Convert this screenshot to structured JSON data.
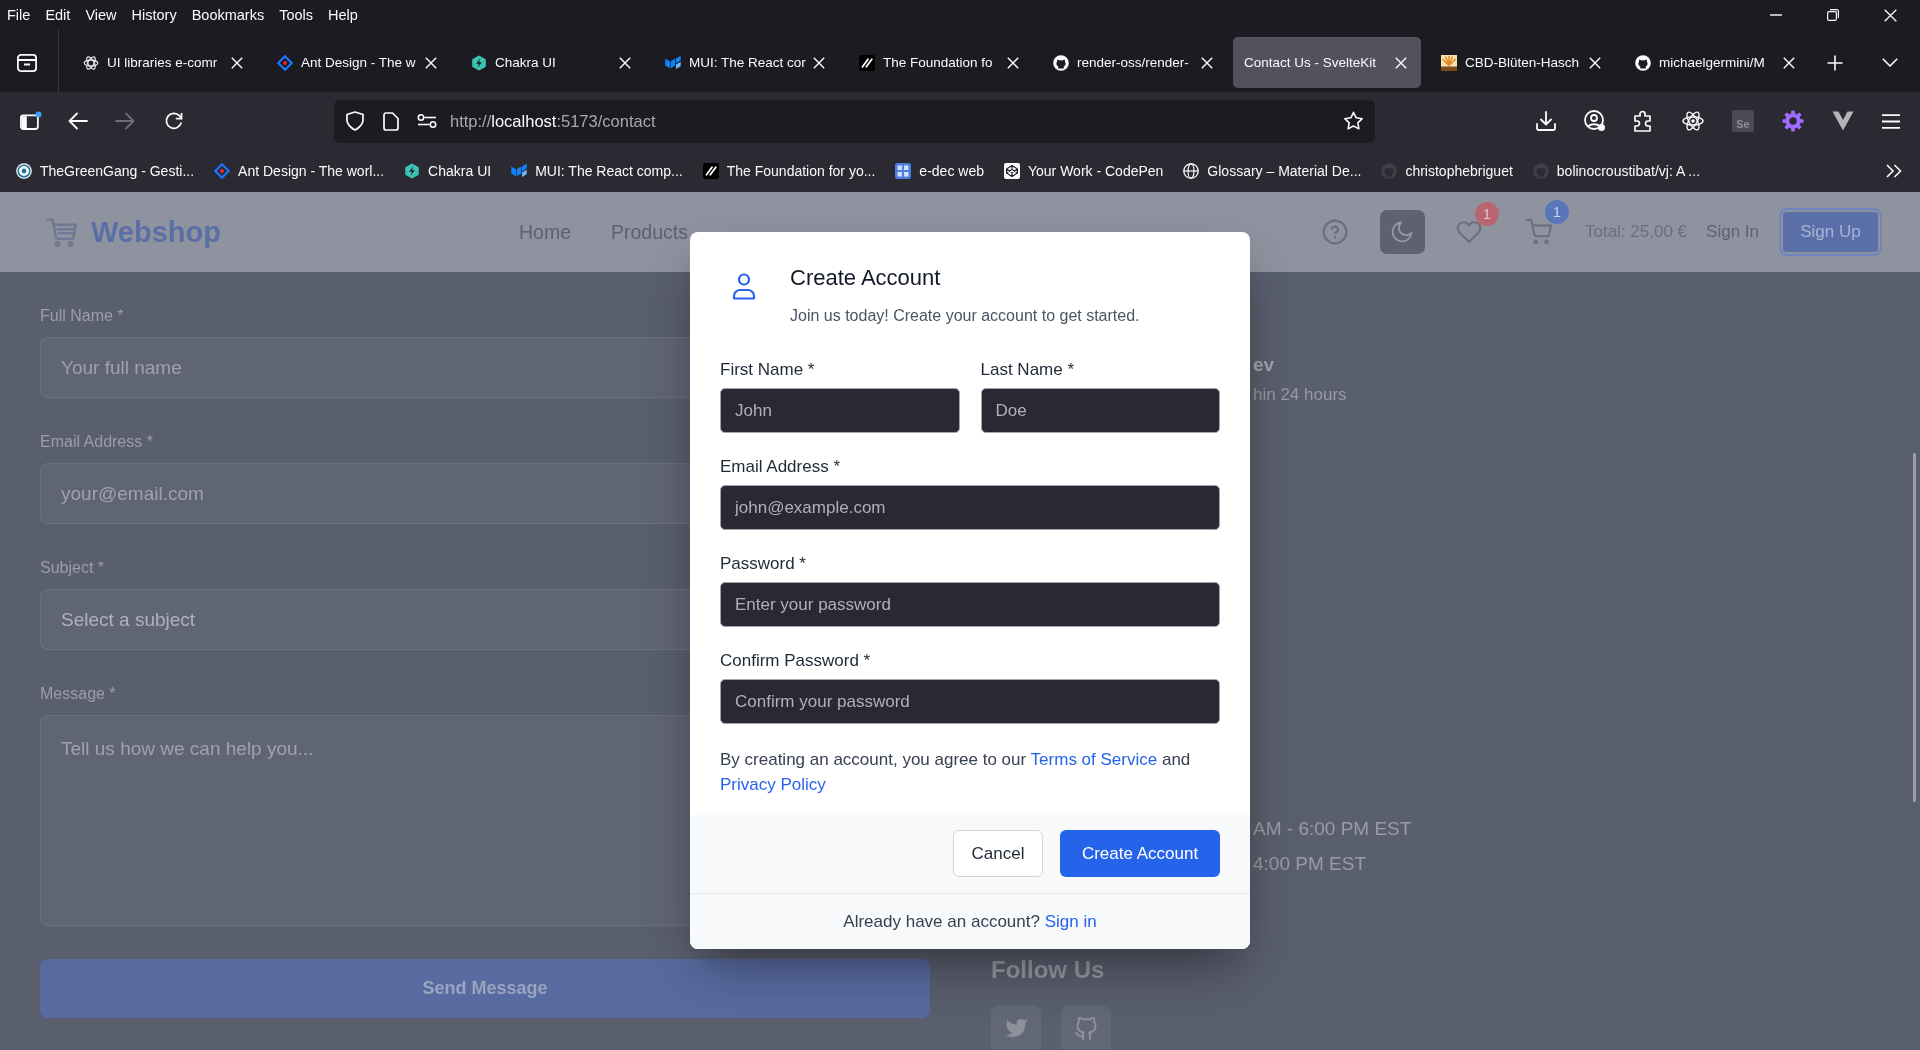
{
  "browser": {
    "menu": [
      "File",
      "Edit",
      "View",
      "History",
      "Bookmarks",
      "Tools",
      "Help"
    ],
    "tabs": [
      {
        "title": "UI libraries e-comr",
        "selected": false
      },
      {
        "title": "Ant Design - The w",
        "selected": false
      },
      {
        "title": "Chakra UI",
        "selected": false
      },
      {
        "title": "MUI: The React cor",
        "selected": false
      },
      {
        "title": "The Foundation fo",
        "selected": false
      },
      {
        "title": "render-oss/render-",
        "selected": false
      },
      {
        "title": "Contact Us - SvelteKit",
        "selected": true
      },
      {
        "title": "CBD-Blüten-Hasch",
        "selected": false
      },
      {
        "title": "michaelgermini/M",
        "selected": false
      }
    ],
    "toolbar": {
      "forward_disabled": true,
      "url": {
        "scheme": "http://",
        "host": "localhost",
        "path": ":5173/contact"
      },
      "extension_label": "Se"
    },
    "bookmarks": [
      "TheGreenGang - Gesti...",
      "Ant Design - The worl...",
      "Chakra UI",
      "MUI: The React comp...",
      "The Foundation for yo...",
      "e-dec web",
      "Your Work - CodePen",
      "Glossary – Material De...",
      "christophebriguet",
      "bolinocroustibat/vj: A ..."
    ]
  },
  "header": {
    "brand": "Webshop",
    "nav": [
      "Home",
      "Products"
    ],
    "favorites_count": "1",
    "cart_count": "1",
    "total": "Total: 25,00 €",
    "sign_in": "Sign In",
    "sign_up": "Sign Up"
  },
  "contact_form": {
    "fields": [
      {
        "kind": "input",
        "label": "Full Name *",
        "placeholder": "Your full name"
      },
      {
        "kind": "input",
        "label": "Email Address *",
        "placeholder": "your@email.com"
      },
      {
        "kind": "select",
        "label": "Subject *",
        "value": "Select a subject"
      },
      {
        "kind": "textarea",
        "label": "Message *",
        "placeholder": "Tell us how we can help you..."
      }
    ],
    "submit": "Send Message"
  },
  "contact_info": {
    "groups": [
      {
        "lines": [
          {
            "kind": "strong",
            "text": "ev"
          },
          {
            "kind": "note",
            "text": "hin 24 hours"
          }
        ]
      },
      {
        "lines": [
          {
            "kind": "hours",
            "text": "AM - 6:00 PM EST"
          },
          {
            "kind": "hours",
            "text": "4:00 PM EST"
          }
        ]
      }
    ],
    "follow_heading": "Follow Us"
  },
  "modal": {
    "title": "Create Account",
    "subtitle": "Join us today! Create your account to get started.",
    "rows": [
      {
        "fields": [
          {
            "label": "First Name *",
            "placeholder": "John"
          },
          {
            "label": "Last Name *",
            "placeholder": "Doe"
          }
        ]
      },
      {
        "fields": [
          {
            "label": "Email Address *",
            "placeholder": "john@example.com"
          }
        ]
      },
      {
        "fields": [
          {
            "label": "Password *",
            "placeholder": "Enter your password"
          }
        ]
      },
      {
        "fields": [
          {
            "label": "Confirm Password *",
            "placeholder": "Confirm your password"
          }
        ]
      }
    ],
    "terms": {
      "before": "By creating an account, you agree to our",
      "terms_link": "Terms of Service",
      "middle": "and",
      "privacy_link": "Privacy Policy"
    },
    "buttons": {
      "cancel": "Cancel",
      "submit": "Create Account"
    },
    "footer": {
      "question": "Already have an account?",
      "link": "Sign in"
    }
  }
}
